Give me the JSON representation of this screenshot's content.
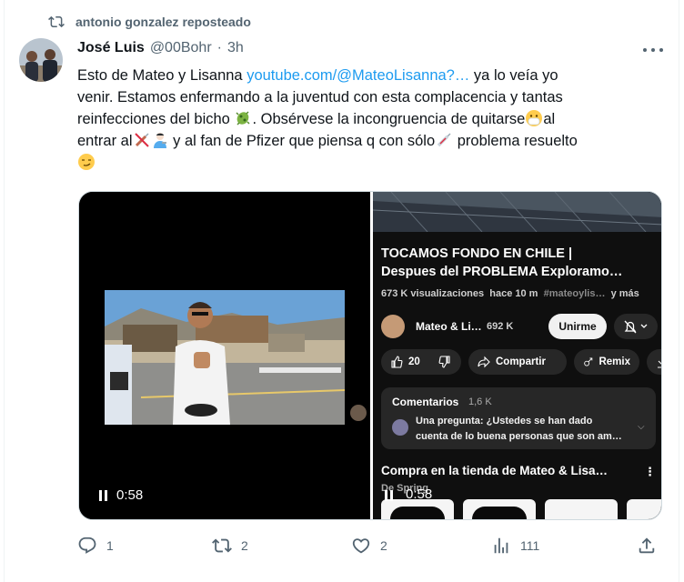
{
  "repost": {
    "label": "antonio gonzalez reposteado",
    "icon": "repost-icon"
  },
  "tweet": {
    "author_name": "José Luis",
    "author_handle": "@00Bohr",
    "separator": "·",
    "time": "3h",
    "text": {
      "l1_a": "Esto de Mateo y Lisanna ",
      "l1_link": "youtube.com/@MateoLisanna?…",
      "l1_b": " ya lo veía yo",
      "l2": "venir. Estamos enfermando a la juventud con esta complacencia y tantas",
      "l3_a": "reinfecciones del bicho ",
      "l3_b": ". Obsérvese la incongruencia de quitarse",
      "l3_c": "al",
      "l4_a": "entrar al",
      "l4_b": " y al fan de Pfizer que piensa q con sólo",
      "l4_c": " problema resuelto"
    }
  },
  "media": {
    "left_video": {
      "time": "0:58"
    },
    "right_video": {
      "title_line1": "TOCAMOS FONDO EN CHILE |",
      "title_line2": "Despues del PROBLEMA Exploramo…",
      "views": "673 K visualizaciones",
      "ago": "hace 10 m",
      "tags": "#mateoylis…",
      "more": "y más",
      "channel_name": "Mateo & Li…",
      "channel_subs": "692 K",
      "subscribe_label": "Unirme",
      "likes": "20",
      "share_label": "Compartir",
      "remix_label": "Remix",
      "comments_title": "Comentarios",
      "comments_count": "1,6 K",
      "comment_line1": "Una pregunta: ¿Ustedes se han dado",
      "comment_line2": "cuenta de lo buena personas que son am…",
      "shop_title": "Compra en la tienda de Mateo & Lisa…",
      "shop_sub": "De Spring",
      "time": "0:58"
    }
  },
  "footer": {
    "replies": "1",
    "reposts": "2",
    "likes": "2",
    "views": "111"
  },
  "colors": {
    "link": "#1d9bf0",
    "muted": "#536471",
    "text": "#0f1419"
  }
}
